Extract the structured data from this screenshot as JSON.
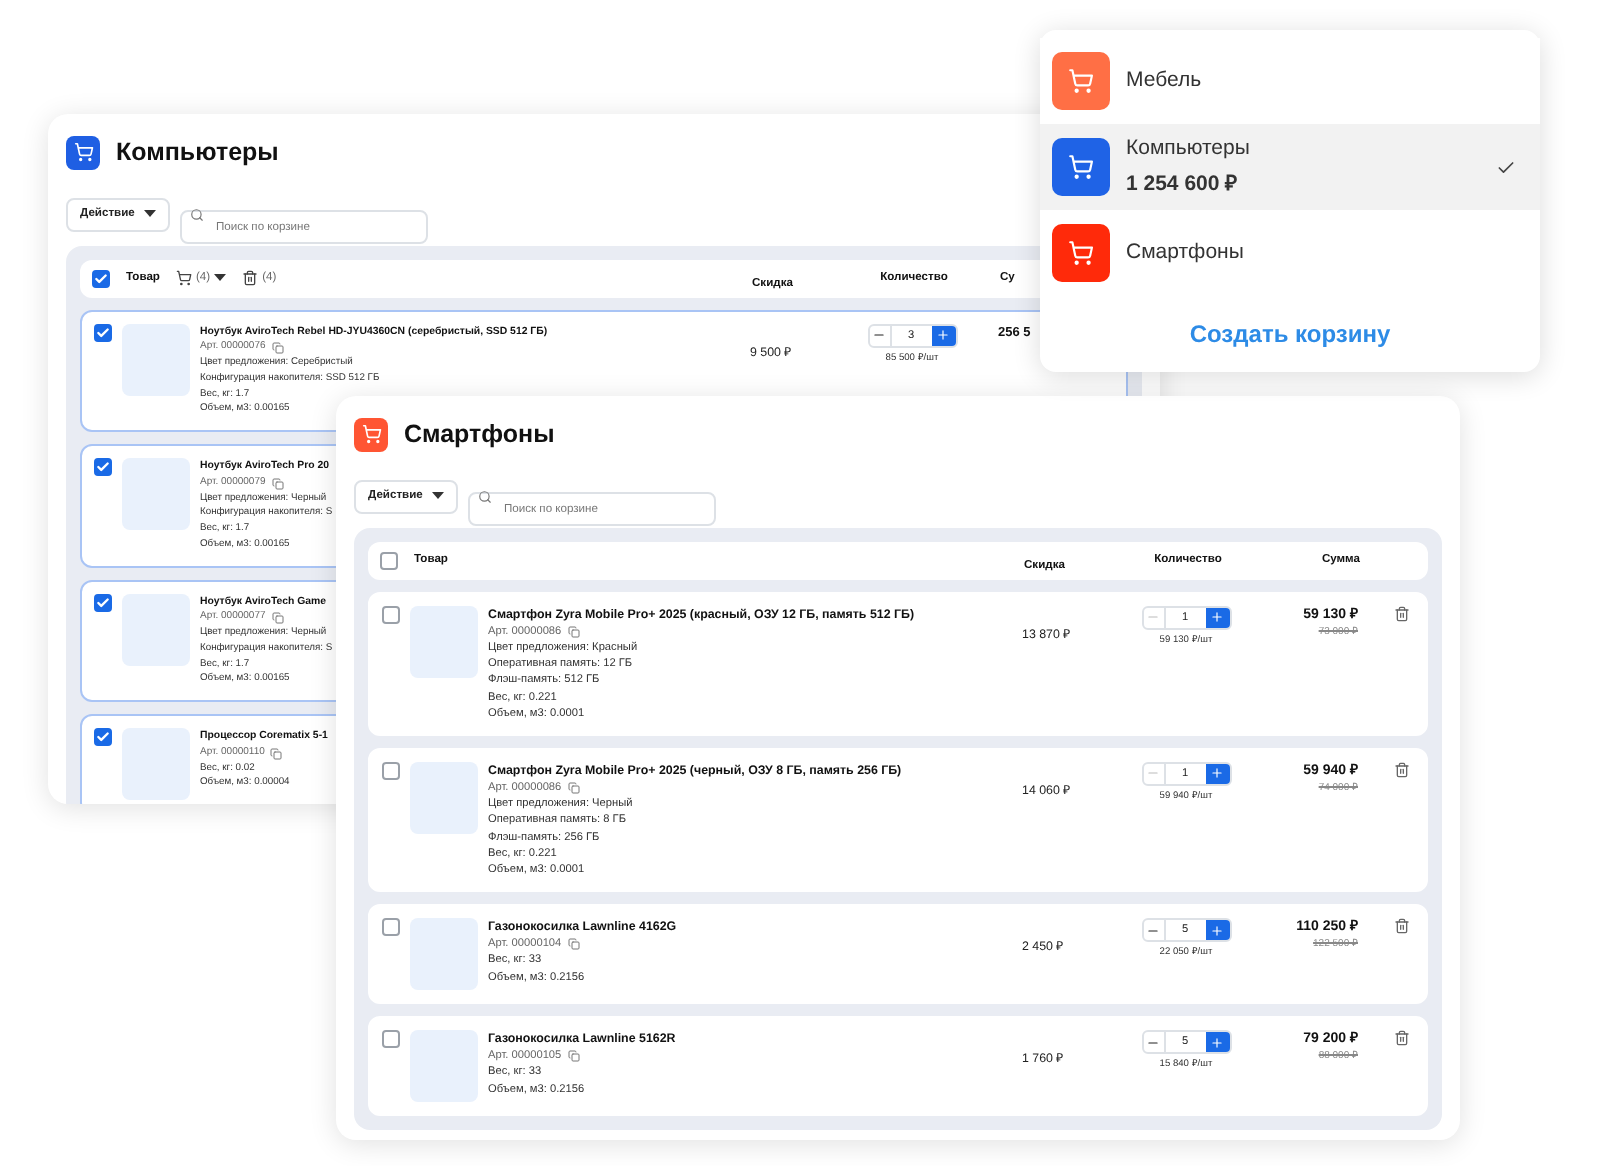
{
  "carts": [
    {
      "title": "Компьютеры",
      "color": "#1f5fe3",
      "action": "Действие",
      "search_placeholder": "Поиск по корзине",
      "table": {
        "all_checked": true,
        "columns": [
          "Товар",
          "Скидка",
          "Количество",
          "Су"
        ],
        "bulk": {
          "cart_count": "(4)",
          "delete_count": "(4)"
        },
        "rows": [
          {
            "checked": true,
            "name": "Ноутбук AviroTech Rebel HD-JYU4360CN (серебристый, SSD 512 ГБ)",
            "sku": "Арт. 00000076",
            "details": [
              "Цвет предложения: Серебристый",
              "Конфигурация накопителя: SSD 512 ГБ",
              "Вес, кг: 1.7",
              "Объем, м3: 0.00165"
            ],
            "discount": "9 500 ₽",
            "quantity": "3",
            "can_decrease": true,
            "unit_price": "85 500 ₽/шт",
            "sum": "256 5"
          },
          {
            "checked": true,
            "name": "Ноутбук AviroTech Pro 20",
            "sku": "Арт. 00000079",
            "details": [
              "Цвет предложения: Черный",
              "Конфигурация накопителя: S",
              "Вес, кг: 1.7",
              "Объем, м3: 0.00165"
            ]
          },
          {
            "checked": true,
            "name": "Ноутбук AviroTech Game",
            "sku": "Арт. 00000077",
            "details": [
              "Цвет предложения: Черный",
              "Конфигурация накопителя: S",
              "Вес, кг: 1.7",
              "Объем, м3: 0.00165"
            ]
          },
          {
            "checked": true,
            "name": "Процессор Corematix 5-1",
            "sku": "Арт. 00000110",
            "details": [
              "Вес, кг: 0.02",
              "Объем, м3: 0.00004"
            ]
          }
        ]
      }
    },
    {
      "title": "Смартфоны",
      "color": "#ff5533",
      "action": "Действие",
      "search_placeholder": "Поиск по корзине",
      "table": {
        "all_checked": false,
        "columns": [
          "Товар",
          "Скидка",
          "Количество",
          "Сумма"
        ],
        "rows": [
          {
            "checked": false,
            "name": "Смартфон Zyra Mobile Pro+ 2025 (красный, ОЗУ 12 ГБ, память 512 ГБ)",
            "sku": "Арт. 00000086",
            "details": [
              "Цвет предложения: Красный",
              "Оперативная память: 12 ГБ",
              "Флэш-память: 512 ГБ",
              "Вес, кг: 0.221",
              "Объем, м3: 0.0001"
            ],
            "discount": "13 870 ₽",
            "quantity": "1",
            "can_decrease": false,
            "unit_price": "59 130 ₽/шт",
            "sum": "59 130 ₽",
            "old_sum": "73 000 ₽"
          },
          {
            "checked": false,
            "name": "Смартфон Zyra Mobile Pro+ 2025 (черный, ОЗУ 8 ГБ, память 256 ГБ)",
            "sku": "Арт. 00000086",
            "details": [
              "Цвет предложения: Черный",
              "Оперативная память: 8 ГБ",
              "Флэш-память: 256 ГБ",
              "Вес, кг: 0.221",
              "Объем, м3: 0.0001"
            ],
            "discount": "14 060 ₽",
            "quantity": "1",
            "can_decrease": false,
            "unit_price": "59 940 ₽/шт",
            "sum": "59 940 ₽",
            "old_sum": "74 000 ₽"
          },
          {
            "checked": false,
            "name": "Газонокосилка Lawnline 4162G",
            "sku": "Арт. 00000104",
            "details": [
              "Вес, кг: 33",
              "Объем, м3: 0.2156"
            ],
            "discount": "2 450 ₽",
            "quantity": "5",
            "can_decrease": true,
            "unit_price": "22 050 ₽/шт",
            "sum": "110 250 ₽",
            "old_sum": "122 500 ₽"
          },
          {
            "checked": false,
            "name": "Газонокосилка Lawnline 5162R",
            "sku": "Арт. 00000105",
            "details": [
              "Вес, кг: 33",
              "Объем, м3: 0.2156"
            ],
            "discount": "1 760 ₽",
            "quantity": "5",
            "can_decrease": true,
            "unit_price": "15 840 ₽/шт",
            "sum": "79 200 ₽",
            "old_sum": "88 000 ₽"
          }
        ]
      }
    }
  ],
  "cart_menu": {
    "items": [
      {
        "name": "Мебель",
        "color": "#ff6f45",
        "selected": false
      },
      {
        "name": "Компьютеры",
        "total": "1 254 600 ₽",
        "color": "#1f63e6",
        "selected": true
      },
      {
        "name": "Смартфоны",
        "color": "#ff2a0a",
        "selected": false
      }
    ],
    "create_link": "Создать корзину"
  }
}
